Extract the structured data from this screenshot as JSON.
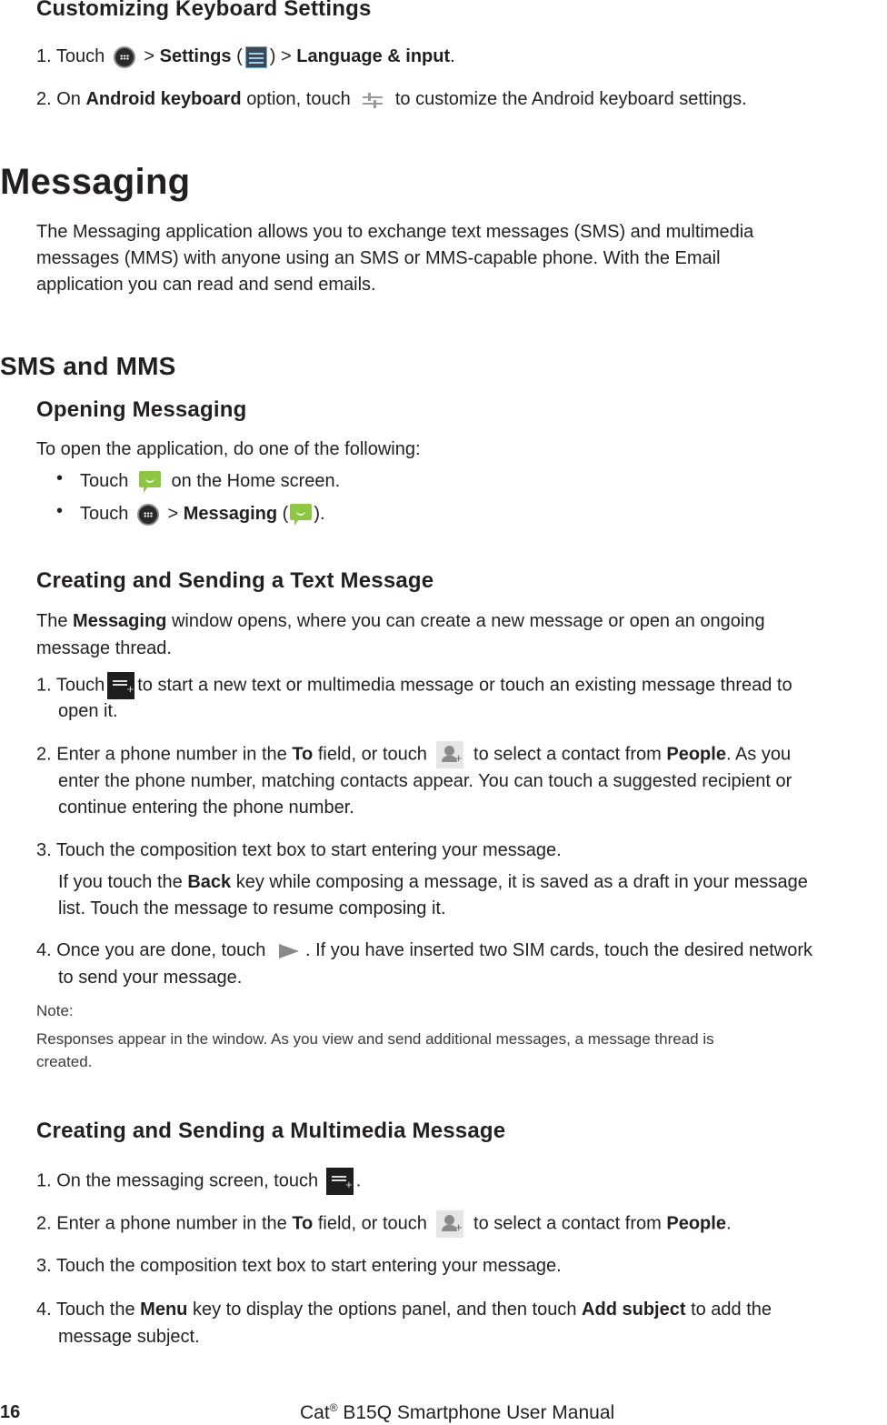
{
  "sections": {
    "keyboard": {
      "heading": "Customizing Keyboard Settings",
      "step1": {
        "num": "1. Touch",
        "gt1": ">",
        "settings": "Settings",
        "paren_open": "(",
        "paren_close": ")",
        "gt2": ">",
        "lang": "Language & input",
        "end": "."
      },
      "step2": {
        "pre": "2. On",
        "bold": "Android keyboard",
        "mid": "option, touch",
        "post": "to customize the Android keyboard settings."
      }
    },
    "messaging": {
      "heading": "Messaging",
      "intro_lines": [
        "The Messaging application allows you to exchange text messages (SMS) and multimedia",
        "messages (MMS) with anyone using an SMS or MMS-capable phone. With the Email",
        "application you can read and send emails."
      ]
    },
    "sms_mms": {
      "heading": "SMS and MMS",
      "opening": {
        "heading": "Opening Messaging",
        "intro": "To open the application, do one of the following:",
        "bullet_char": "•",
        "bullet1": {
          "pre": "Touch",
          "post": "on the Home screen."
        },
        "bullet2": {
          "pre": "Touch",
          "gt": ">",
          "bold": "Messaging",
          "open": "(",
          "close": ")."
        }
      },
      "text_message": {
        "heading": "Creating and Sending a Text Message",
        "intro1_pre": "The",
        "intro1_bold": "Messaging",
        "intro1_post": "window opens, where you can create a new message or open an ongoing",
        "intro2": "message thread.",
        "step1": {
          "pre": "1. Touch",
          "post": "to start a new text or multimedia message or touch an existing message thread to",
          "cont": "open it."
        },
        "step2": {
          "pre": "2. Enter a phone number in the",
          "bold1": "To",
          "mid": "field, or touch",
          "mid2": "to select a contact from",
          "bold2": "People",
          "post": ". As you",
          "cont1": "enter the phone number, matching contacts appear. You can touch a suggested recipient or",
          "cont2": "continue entering the phone number."
        },
        "step3": {
          "text": "3. Touch the composition text box to start entering your message.",
          "sub_pre": "If you touch the",
          "sub_bold": "Back",
          "sub_post": "key while composing a message, it is saved as a draft in your message",
          "sub_cont": "list. Touch the message to resume composing it."
        },
        "step4": {
          "pre": "4. Once you are done, touch",
          "post": ". If you have inserted two SIM cards, touch the desired network",
          "cont": "to send your message."
        },
        "note_label": "Note:",
        "note_line1": "Responses appear in the window. As you view and send additional messages, a message thread is",
        "note_line2": "created."
      },
      "multimedia": {
        "heading": "Creating and Sending a Multimedia Message",
        "step1": {
          "pre": "1. On the messaging screen, touch",
          "post": "."
        },
        "step2": {
          "pre": "2. Enter a phone number in the",
          "bold1": "To",
          "mid": "field, or touch",
          "mid2": "to select a contact from",
          "bold2": "People",
          "post": "."
        },
        "step3": {
          "text": "3. Touch the composition text box to start entering your message."
        },
        "step4": {
          "pre": "4. Touch the",
          "bold1": "Menu",
          "mid": "key to display the options panel, and then touch",
          "bold2": "Add subject",
          "post": "to add the",
          "cont": "message subject."
        }
      }
    }
  },
  "footer": {
    "page_number": "16",
    "title_pre": "Cat",
    "title_sup": "®",
    "title_post": " B15Q Smartphone User Manual"
  }
}
